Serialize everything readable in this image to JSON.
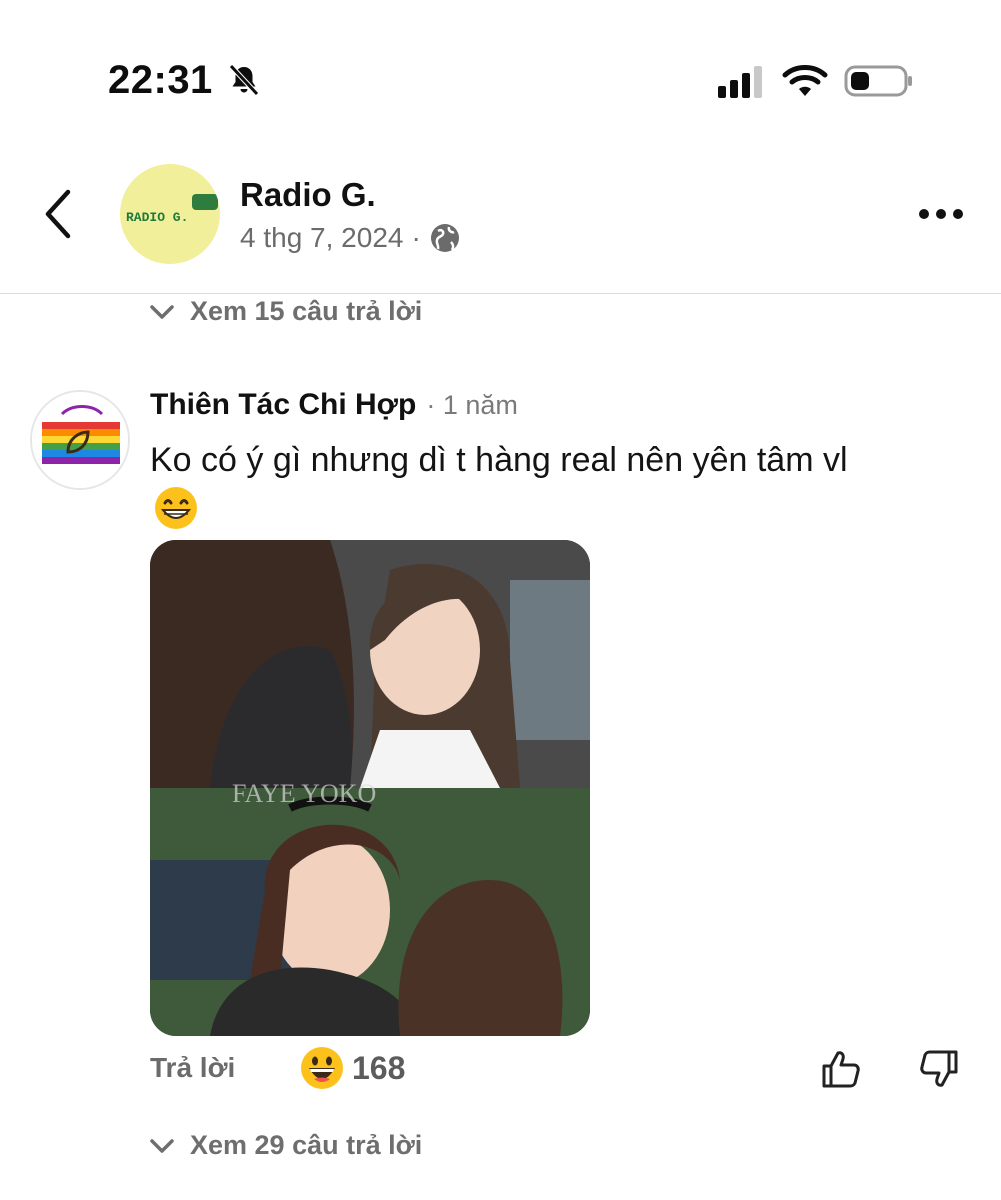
{
  "status_bar": {
    "time": "22:31",
    "icons": [
      "bell-slash-icon",
      "signal-icon",
      "wifi-icon",
      "battery-icon"
    ]
  },
  "post_header": {
    "page_name": "Radio G.",
    "post_date": "4 thg 7, 2024",
    "separator": "·",
    "avatar_text": "RADIO G.",
    "icons": [
      "back-chevron-icon",
      "globe-icon",
      "more-icon"
    ]
  },
  "replies_top": {
    "label": "Xem 15 câu trả lời"
  },
  "comment": {
    "author": "Thiên Tác Chi Hợp",
    "time": "· 1 năm",
    "text": "Ko có ý gì nhưng dì t hàng real nên yên tâm vl",
    "emoji": "grinning-face-emoji",
    "media_watermark": "FAYE YOKO",
    "reply_label": "Trả lời",
    "reaction_emoji": "laughing-face-emoji",
    "reaction_count": "168",
    "icons": [
      "thumbs-up-icon",
      "thumbs-down-icon"
    ]
  },
  "replies_bottom": {
    "label": "Xem 29 câu trả lời"
  },
  "colors": {
    "text_primary": "#111111",
    "text_secondary": "#6b6b6b",
    "avatar_bg": "#f2ef9a",
    "avatar_accent": "#2e7d3f",
    "divider": "#dcdcdc"
  }
}
